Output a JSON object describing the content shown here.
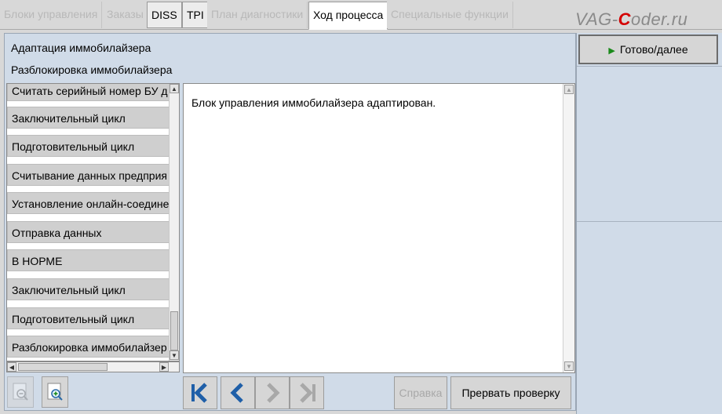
{
  "tabs": [
    {
      "label": "Блоки управления",
      "state": "disabled"
    },
    {
      "label": "Заказы",
      "state": "disabled"
    },
    {
      "label": "DISS",
      "state": "enabled"
    },
    {
      "label": "TPI",
      "state": "enabled"
    },
    {
      "label": "План диагностики",
      "state": "disabled"
    },
    {
      "label": "Ход процесса",
      "state": "active"
    },
    {
      "label": "Специальные функции",
      "state": "disabled"
    }
  ],
  "watermark": {
    "prefix": "VAG-",
    "highlight": "C",
    "suffix": "oder.ru"
  },
  "header": {
    "line1": "Адаптация иммобилайзера",
    "line2": "Разблокировка иммобилайзера"
  },
  "steps": [
    "Считать серийный номер БУ д",
    "Заключительный цикл",
    "Подготовительный цикл",
    "Считывание данных предприя",
    "Установление онлайн-соедине",
    "Отправка данных",
    "В НОРМЕ",
    "Заключительный цикл",
    "Подготовительный цикл",
    "Разблокировка иммобилайзер"
  ],
  "message": "Блок управления иммобилайзера адаптирован.",
  "toolbar": {
    "help_label": "Справка",
    "abort_label": "Прервать проверку"
  },
  "done_button": {
    "label": "Готово/далее"
  },
  "colors": {
    "accent_play": "#1a8a1a",
    "panel_bg": "#d0dbe8",
    "logo_red": "#d40000"
  }
}
